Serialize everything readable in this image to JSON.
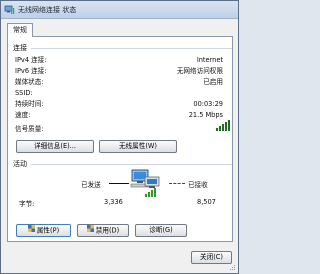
{
  "window": {
    "title": "无线网络连接 状态"
  },
  "tab": {
    "label": "常规"
  },
  "connection": {
    "section_title": "连接",
    "rows": [
      {
        "label": "IPv4 连接:",
        "value": "Internet"
      },
      {
        "label": "IPv6 连接:",
        "value": "无网络访问权限"
      },
      {
        "label": "媒体状态:",
        "value": "已启用"
      },
      {
        "label": "SSID:",
        "value": ""
      },
      {
        "label": "持续时间:",
        "value": "00:03:29"
      },
      {
        "label": "速度:",
        "value": "21.5 Mbps"
      }
    ],
    "signal_label": "信号质量:",
    "signal_bars": 5
  },
  "buttons": {
    "details": "详细信息(E)...",
    "wireless_props": "无线属性(W)",
    "properties": "属性(P)",
    "disable": "禁用(D)",
    "diagnose": "诊断(G)",
    "close": "关闭(C)"
  },
  "activity": {
    "section_title": "活动",
    "sent_label": "已发送",
    "received_label": "已接收",
    "bytes_label": "字节:",
    "sent_bytes": "3,336",
    "received_bytes": "8,507"
  },
  "colors": {
    "signal": "#2e9a2e",
    "accent": "#3c7fb1"
  }
}
